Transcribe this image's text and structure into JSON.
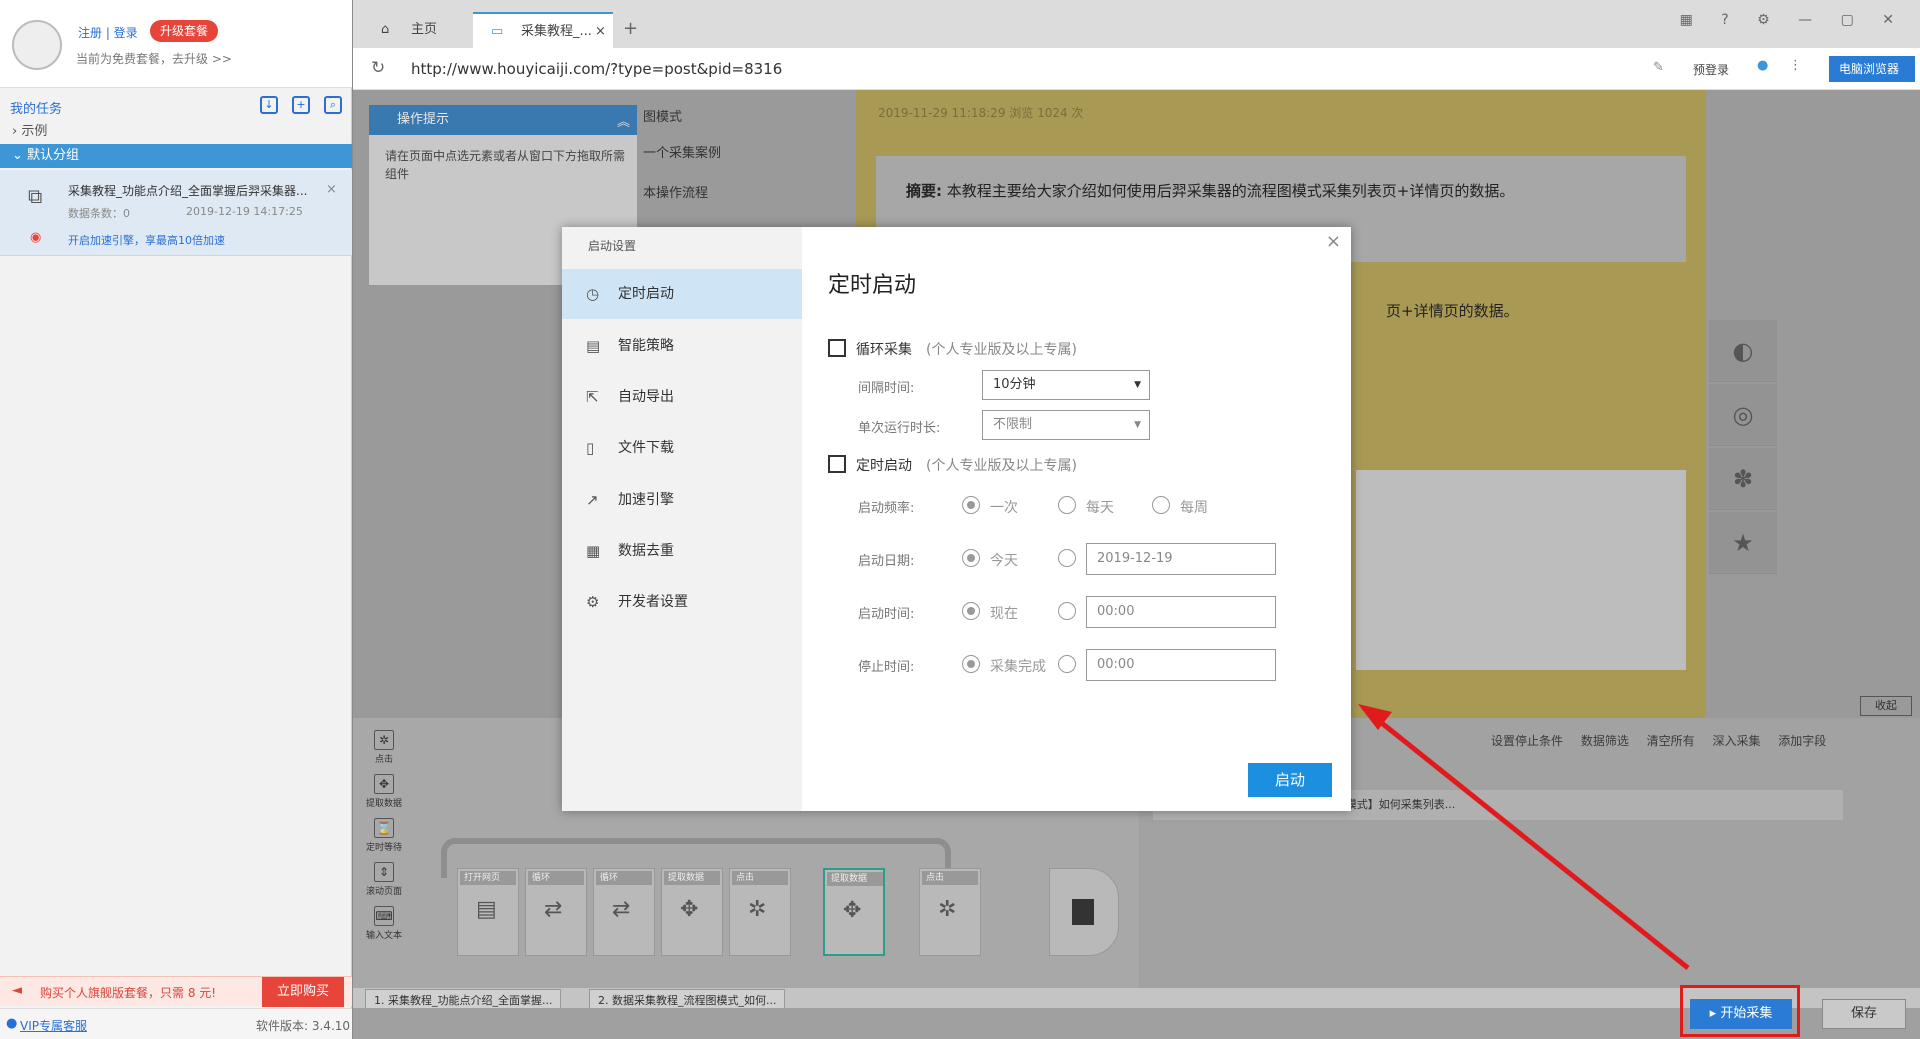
{
  "account": {
    "login": "注册 | 登录",
    "upgrade": "升级套餐",
    "plan_note": "当前为免费套餐，去升级 >>"
  },
  "tasks": {
    "header": "我的任务",
    "tree": [
      "示例",
      "默认分组"
    ],
    "task_name": "采集教程_功能点介绍_全面掌握后羿采集器...",
    "data_count": "数据条数：0",
    "date": "2019-12-19 14:17:25",
    "accel_note": "开启加速引擎，享最高10倍加速"
  },
  "promo": {
    "text": "购买个人旗舰版套餐，只需 8 元!",
    "buy": "立即购买"
  },
  "footer": {
    "vip": "VIP专属客服",
    "version": "软件版本: 3.4.10"
  },
  "browser": {
    "tabs": [
      "主页",
      "采集教程_..."
    ],
    "url": "http://www.houyicaiji.com/?type=post&pid=8316",
    "prelogin": "预登录",
    "browser_select": "电脑浏览器"
  },
  "page": {
    "hint_title": "操作提示",
    "hint_body": "请在页面中点选元素或者从窗口下方拖取所需组件",
    "menu": [
      "图模式",
      "一个采集案例",
      "本操作流程"
    ],
    "meta": "2019-11-29 11:18:29   浏览 1024 次",
    "summary_label": "摘要:",
    "summary": "本教程主要给大家介绍如何使用后羿采集器的流程图模式采集列表页+详情页的数据。",
    "summary_tail": "页+详情页的数据。"
  },
  "flow": {
    "tools": [
      "点击",
      "提取数据",
      "定时等待",
      "滚动页面",
      "输入文本"
    ],
    "nodes": [
      "打开网页",
      "循环",
      "循环",
      "提取数据",
      "点击",
      "提取数据",
      "点击"
    ]
  },
  "rightpanel": {
    "toolbar": "设置停止条件 数据筛选 清空所有 深入采集 添加字段",
    "row": "集列表页+详情页类型的网页 【流程图模式】如何采集列表...",
    "fold": "收起"
  },
  "bottom_tabs": [
    "1. 采集教程_功能点介绍_全面掌握...",
    "2. 数据采集教程_流程图模式_如何..."
  ],
  "buttons": {
    "start": "开始采集",
    "save": "保存"
  },
  "modal": {
    "side_title": "启动设置",
    "menu": [
      "定时启动",
      "智能策略",
      "自动导出",
      "文件下载",
      "加速引擎",
      "数据去重",
      "开发者设置"
    ],
    "title": "定时启动",
    "loop_label": "循环采集",
    "loop_note": "(个人专业版及以上专属)",
    "interval_label": "间隔时间:",
    "interval_value": "10分钟",
    "duration_label": "单次运行时长:",
    "duration_value": "不限制",
    "timed_label": "定时启动",
    "timed_note": "(个人专业版及以上专属)",
    "freq_label": "启动频率:",
    "freq_options": [
      "一次",
      "每天",
      "每周"
    ],
    "date_label": "启动日期:",
    "date_option": "今天",
    "date_value": "2019-12-19",
    "time_label": "启动时间:",
    "time_option": "现在",
    "time_value": "00:00",
    "stop_label": "停止时间:",
    "stop_option": "采集完成",
    "stop_value": "00:00",
    "launch": "启动"
  },
  "colors": {
    "accent": "#2a7bd3",
    "annotation": "#e01b1b",
    "promo": "#e7443a"
  }
}
